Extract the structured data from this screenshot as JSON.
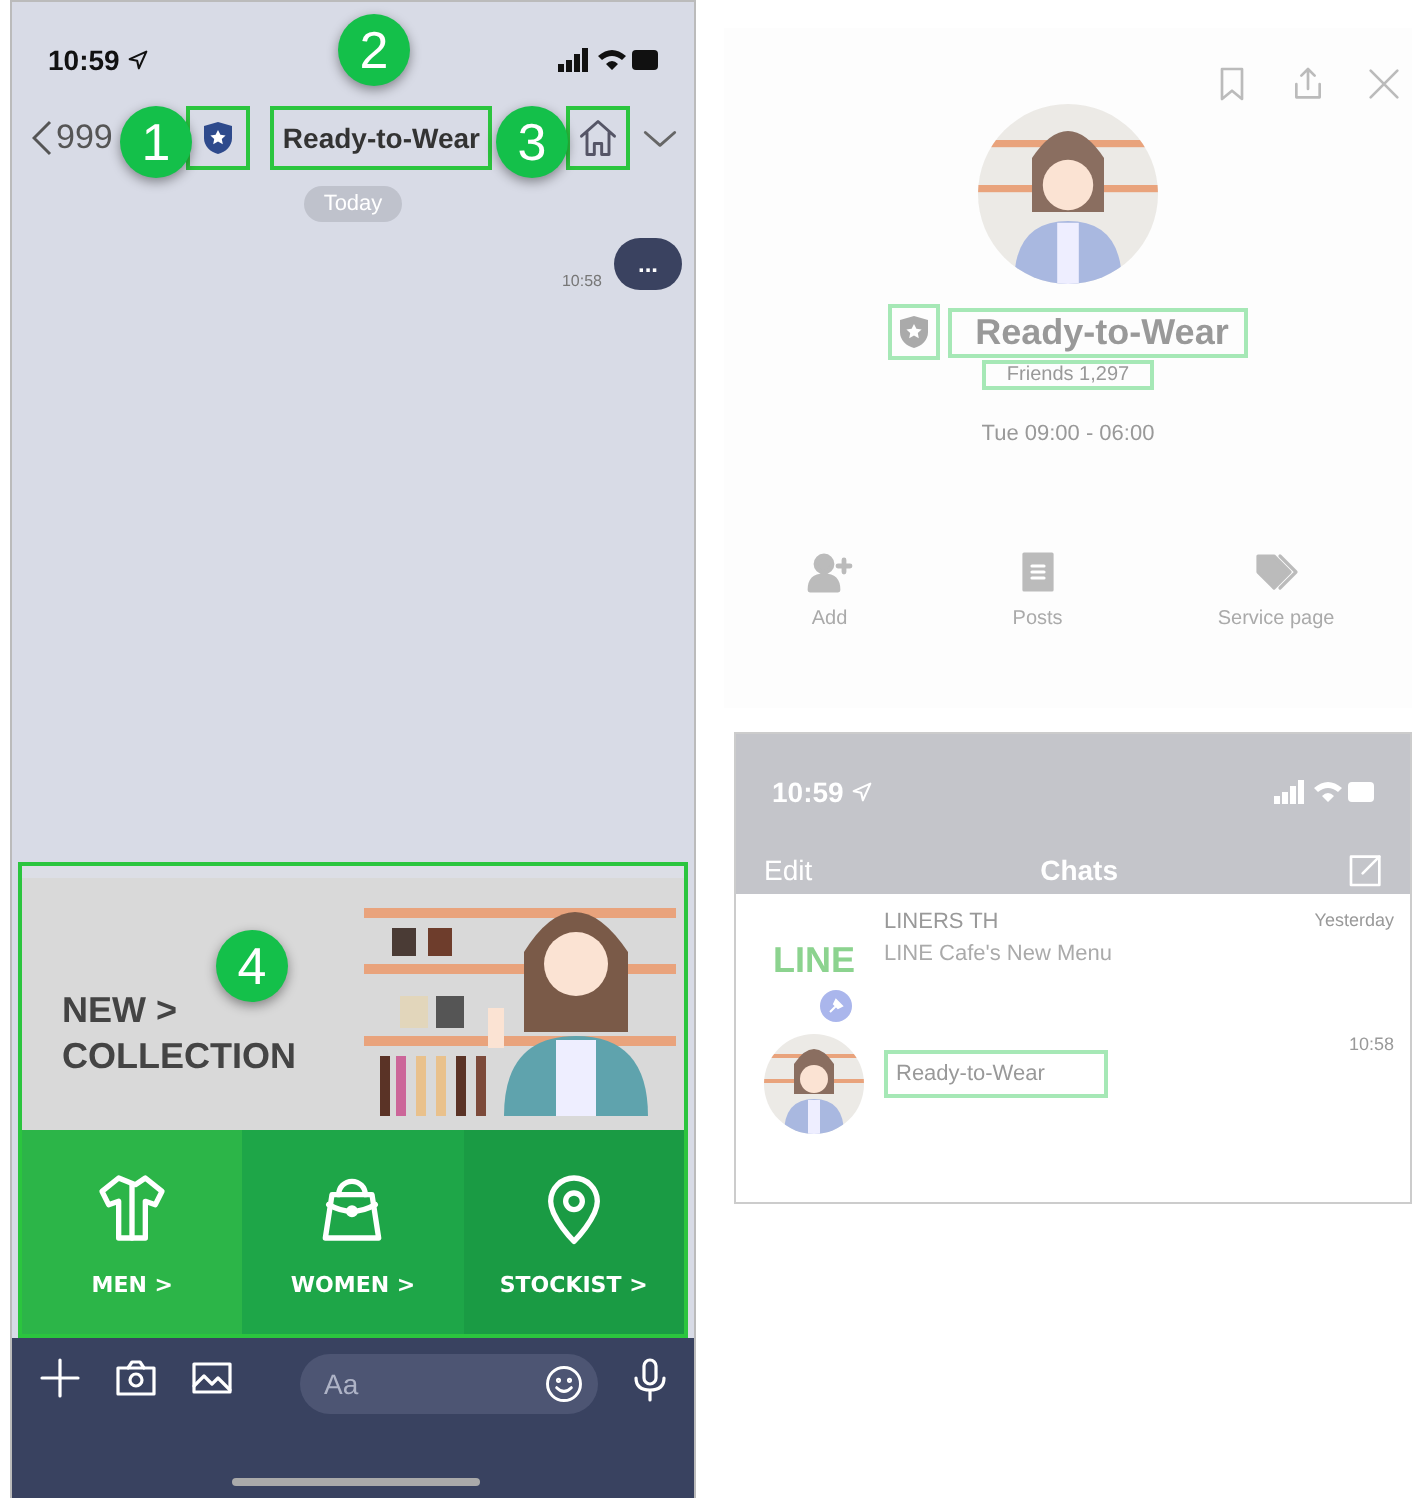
{
  "chat_screen": {
    "status_time": "10:59",
    "back_label": "999",
    "title": "Ready-to-Wear",
    "date_chip": "Today",
    "messages": [
      {
        "time": "10:58",
        "text": "..."
      }
    ],
    "banner": {
      "lines": [
        "NEW >",
        "COLLECTION"
      ]
    },
    "menu": [
      {
        "label": "MEN >",
        "kind": "shirt"
      },
      {
        "label": "WOMEN >",
        "kind": "bag"
      },
      {
        "label": "STOCKIST >",
        "kind": "pin"
      }
    ],
    "input": {
      "placeholder": "Aa"
    }
  },
  "callouts": [
    "1",
    "2",
    "3",
    "4"
  ],
  "profile": {
    "name": "Ready-to-Wear",
    "friends": "Friends 1,297",
    "hours": "Tue 09:00 - 06:00",
    "actions": [
      {
        "label": "Add",
        "kind": "add"
      },
      {
        "label": "Posts",
        "kind": "posts"
      },
      {
        "label": "Service page",
        "kind": "tag"
      }
    ]
  },
  "chats_screen": {
    "status_time": "10:59",
    "edit": "Edit",
    "title": "Chats",
    "items": [
      {
        "kind": "logo",
        "logo": "LINE",
        "name": "LINERS TH",
        "preview": "LINE Cafe's New Menu",
        "time": "Yesterday"
      },
      {
        "kind": "photo",
        "name": "Ready-to-Wear",
        "time": "10:58"
      }
    ]
  }
}
